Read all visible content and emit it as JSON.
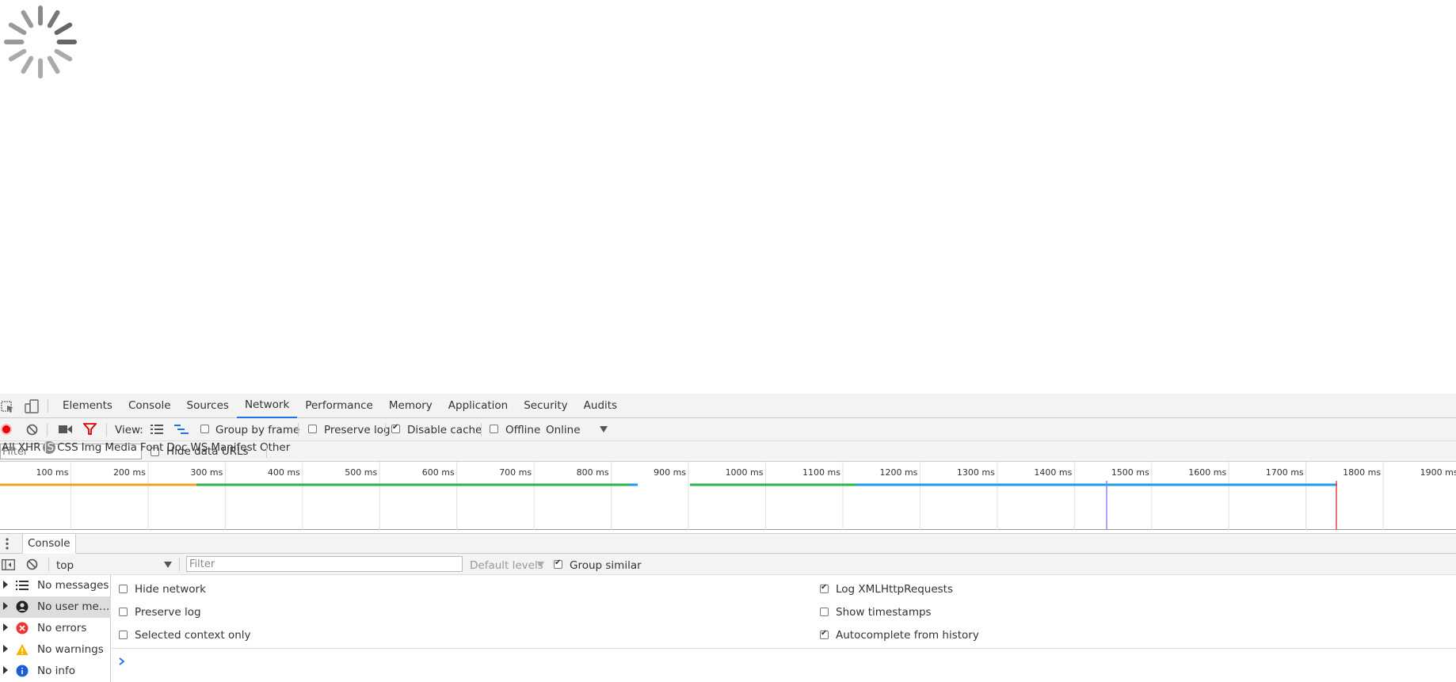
{
  "devtools_tabs": [
    "Elements",
    "Console",
    "Sources",
    "Network",
    "Performance",
    "Memory",
    "Application",
    "Security",
    "Audits"
  ],
  "active_tab": "Network",
  "network_toolbar": {
    "view_label": "View:",
    "group_by_frame": "Group by frame",
    "preserve_log": "Preserve log",
    "disable_cache": "Disable cache",
    "offline": "Offline",
    "throttle_value": "Online"
  },
  "filter_bar": {
    "filter_placeholder": "Filter",
    "hide_data_urls": "Hide data URLs",
    "types": [
      "All",
      "XHR",
      "JS",
      "CSS",
      "Img",
      "Media",
      "Font",
      "Doc",
      "WS",
      "Manifest",
      "Other"
    ],
    "active_type": "JS"
  },
  "timeline": {
    "ticks": [
      "100 ms",
      "200 ms",
      "300 ms",
      "400 ms",
      "500 ms",
      "600 ms",
      "700 ms",
      "800 ms",
      "900 ms",
      "1000 ms",
      "1100 ms",
      "1200 ms",
      "1300 ms",
      "1400 ms",
      "1500 ms",
      "1600 ms",
      "1700 ms",
      "1800 ms",
      "1900 ms"
    ],
    "colors": {
      "waiting": "#f0a21f",
      "connect": "#2db34a",
      "download": "#1e9be9",
      "dom_content_loaded": "#8888ff",
      "load": "#e54545"
    }
  },
  "drawer": {
    "tab_label": "Console",
    "context": "top",
    "filter_placeholder": "Filter",
    "levels": "Default levels",
    "group_similar": "Group similar"
  },
  "console_sidebar": [
    {
      "label": "No messages",
      "icon": "list-icon"
    },
    {
      "label": "No user mess...",
      "icon": "user-icon"
    },
    {
      "label": "No errors",
      "icon": "error-icon"
    },
    {
      "label": "No warnings",
      "icon": "warning-icon"
    },
    {
      "label": "No info",
      "icon": "info-icon"
    }
  ],
  "console_settings": {
    "hide_network": "Hide network",
    "preserve_log": "Preserve log",
    "selected_context_only": "Selected context only",
    "log_xhr": "Log XMLHttpRequests",
    "show_timestamps": "Show timestamps",
    "autocomplete": "Autocomplete from history"
  }
}
